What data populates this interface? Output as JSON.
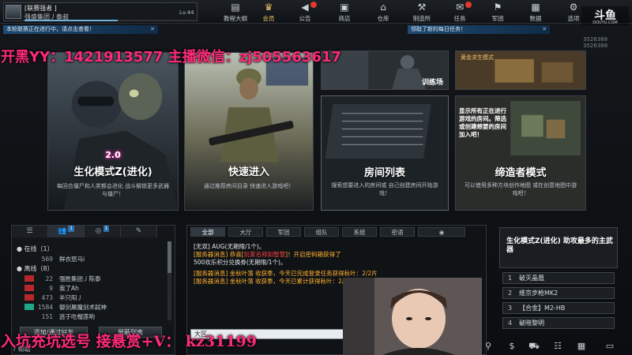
{
  "player": {
    "rank": "[联赛强者 ]",
    "guild": "强盛集团丿泰叔",
    "level": "Lv.44",
    "xp_progress": 0.55
  },
  "nav": [
    {
      "label": "教程大纲",
      "icon": "book-icon"
    },
    {
      "label": "会员",
      "icon": "crown-icon"
    },
    {
      "label": "公告",
      "icon": "megaphone-icon"
    },
    {
      "label": "商店",
      "icon": "shop-icon"
    },
    {
      "label": "仓库",
      "icon": "warehouse-icon"
    },
    {
      "label": "制造所",
      "icon": "factory-icon"
    },
    {
      "label": "任务",
      "icon": "mission-icon"
    },
    {
      "label": "军团",
      "icon": "army-icon"
    },
    {
      "label": "数据",
      "icon": "data-icon"
    },
    {
      "label": "选项",
      "icon": "settings-icon"
    }
  ],
  "notices": {
    "left": "本轮联赛正在进行中，请点击查看！",
    "right": "领取了新的每日任务！"
  },
  "coords": {
    "a": "3526388",
    "b": "3526388"
  },
  "overlay": {
    "top": "开黑YY：1421913577 主播微信：zj505563617",
    "bottom": "入坑充坑选号 接悬赏+V： kz31199"
  },
  "cards": {
    "bio": {
      "title": "生化模式Z(进化)",
      "version": "2.0",
      "desc": "每回合僵尸和人类都会进化 战斗解锁更多武器与僵尸！"
    },
    "quick": {
      "title": "快速进入",
      "desc": "通过推荐房间目录 快速进入游戏吧！"
    },
    "training": {
      "title": "训练场"
    },
    "craft": {
      "title": "黄金求生模式"
    },
    "room": {
      "title": "房间列表",
      "desc": "搜索想要进入的房间或 自己创建房间开始游戏！"
    },
    "creator": {
      "title": "缔造者模式",
      "desc": "可以使用多种方块创作地图 或在创意地图中游戏吧！",
      "note": "显示所有正在进行游戏的房间。筛选或创建想要的房间加入吧！"
    }
  },
  "friends": {
    "tabs": [
      {
        "icon": "list-icon",
        "count": ""
      },
      {
        "icon": "friends-icon",
        "count": "1"
      },
      {
        "icon": "group-icon",
        "count": "1"
      },
      {
        "icon": "mail-icon",
        "count": ""
      }
    ],
    "online_label": "在线（1）",
    "offline_label": "离线（8）",
    "online": [
      {
        "num": "569",
        "name": "鲜衣怒马i"
      }
    ],
    "offline": [
      {
        "num": "22",
        "name": "强胜集团丿陈泰"
      },
      {
        "num": "9",
        "name": "我了Ah"
      },
      {
        "num": "473",
        "name": "半只阳丿"
      },
      {
        "num": "1584",
        "name": "御剑屠魔剑术弑神"
      },
      {
        "num": "151",
        "name": "逃于吃榴莲哟"
      }
    ],
    "add_button": "添加/通过好友",
    "block_button": "屏蔽列表",
    "help": "帮助"
  },
  "chat": {
    "tabs": [
      "全部",
      "大厅",
      "军团",
      "组队",
      "系统",
      "密语"
    ],
    "lines": [
      {
        "style": "white",
        "text": "[无双] AUG(无期限/1个)。"
      },
      {
        "style": "orange",
        "text": "[服务器消息] 恭喜[",
        "hl": "玩家名称如智慧",
        "text2": "]！开启密码箱获得了"
      },
      {
        "style": "white",
        "text": "500欢乐积分兑换券(无期限/1个)。"
      },
      {
        "style": "orange",
        "text": "[服务器消息] 金秋叶落 收获季，今天已完成登录任务获得秋叶：2/2片"
      },
      {
        "style": "orange",
        "text": "[服务器消息] 金秋叶落 收获季，今天已累计获得秋叶：2/48片"
      }
    ],
    "input_value": "大区"
  },
  "news": {
    "title": "生化模式Z(进化) 助攻最多的主武器"
  },
  "stats": [
    {
      "num": "1",
      "name": "破灭晶凰"
    },
    {
      "num": "2",
      "name": "维京步枪MK2"
    },
    {
      "num": "3",
      "name": "【合金】M2-HB"
    },
    {
      "num": "4",
      "name": "破晓黎明"
    }
  ],
  "bottom_icons": [
    "run-icon",
    "dollar-icon",
    "cart-icon",
    "calendar-icon",
    "ticket-icon",
    "battery-icon"
  ]
}
